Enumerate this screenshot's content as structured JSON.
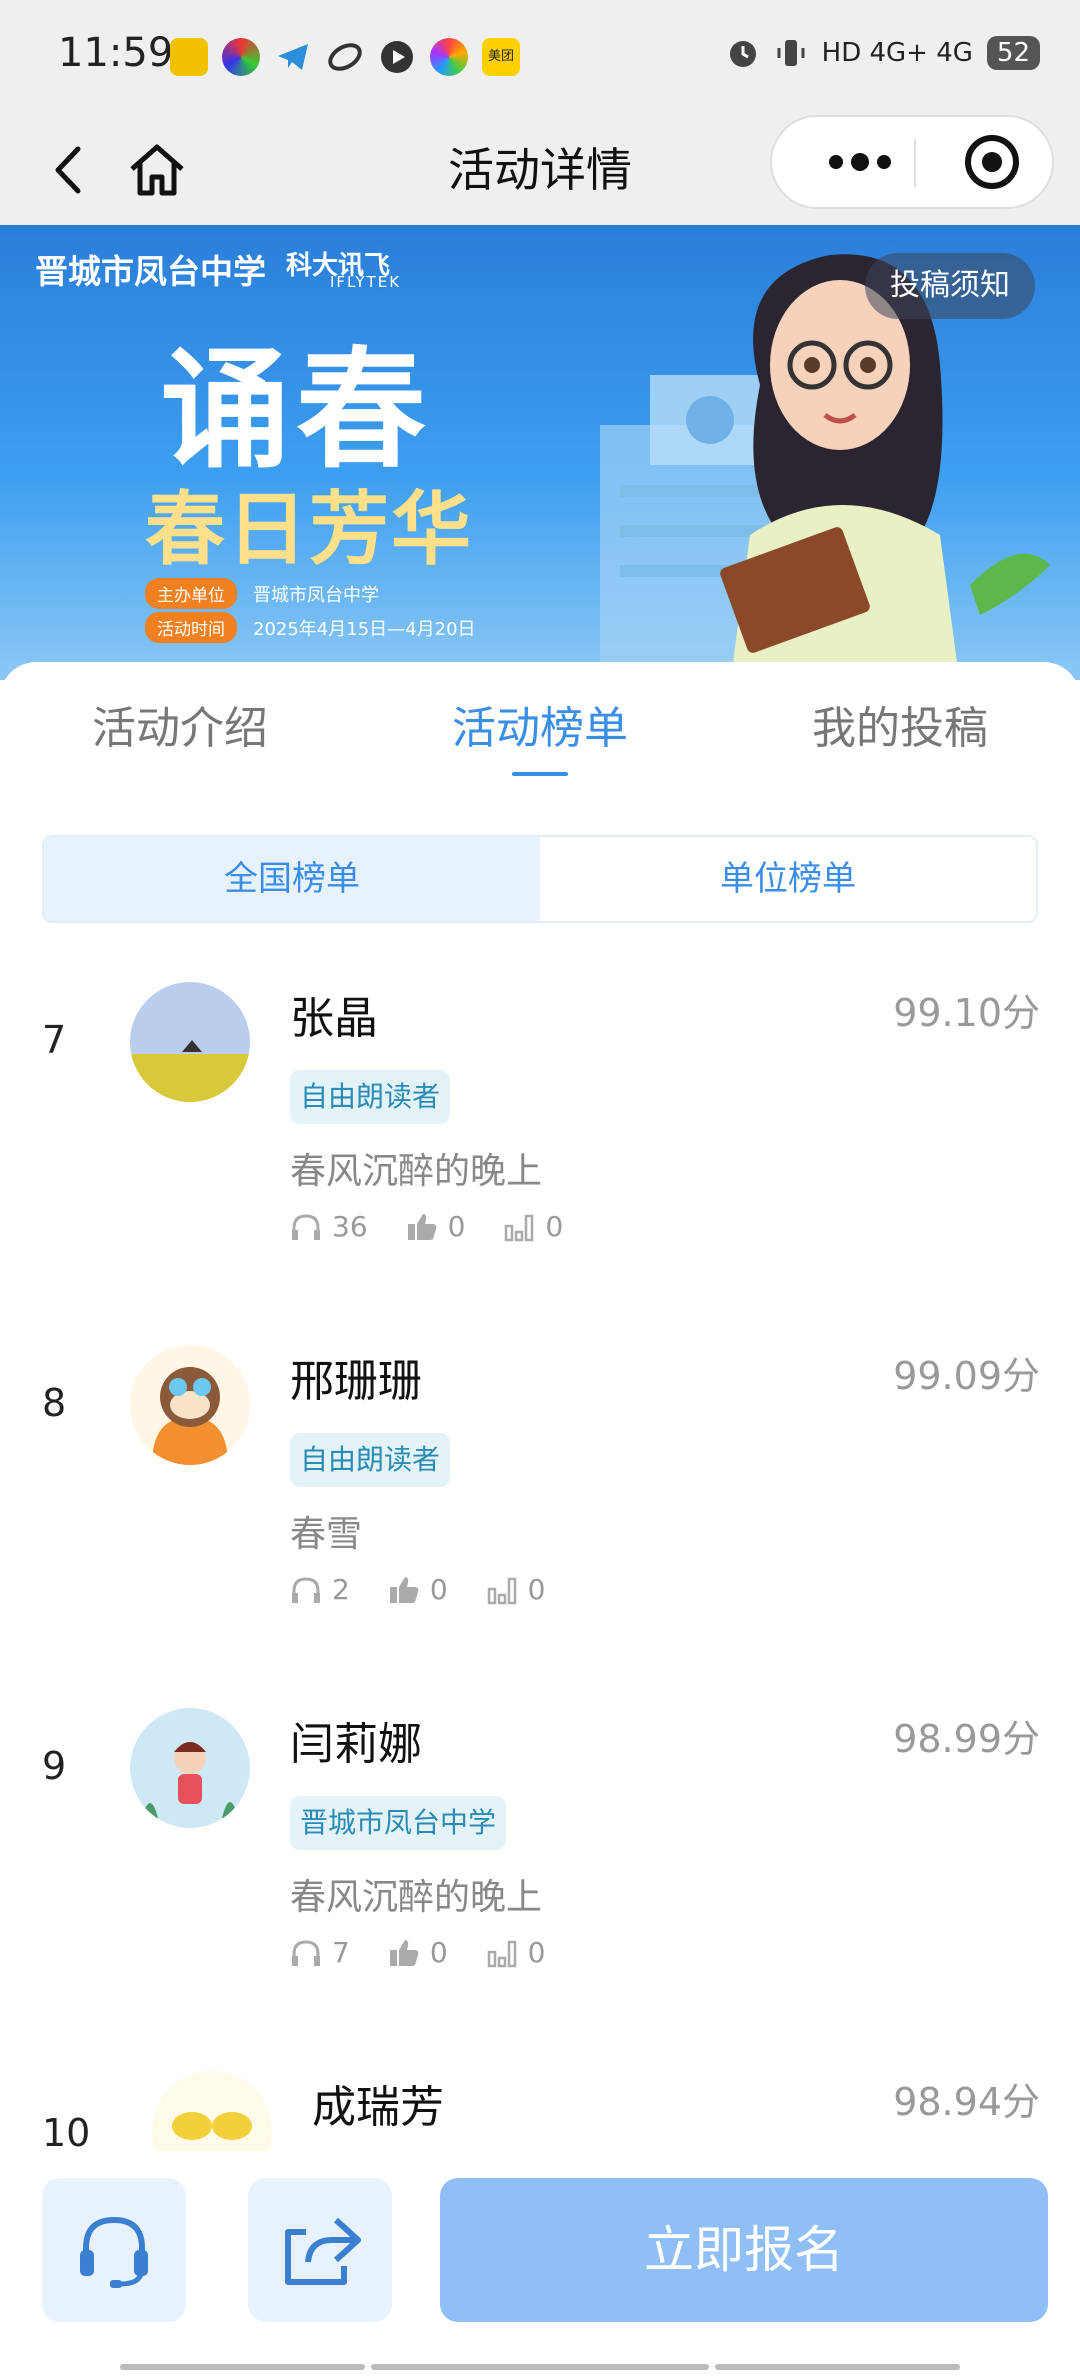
{
  "status_bar": {
    "time": "11:59",
    "notification_icons": [
      "tool-app-icon",
      "color-app-icon",
      "telegram-icon",
      "pay-app-icon",
      "video-app-icon",
      "photos-app-icon",
      "meituan-icon"
    ],
    "meituan_label": "美团",
    "signal_text": "HD 4G+ 4G",
    "battery": "52"
  },
  "nav": {
    "title": "活动详情"
  },
  "banner": {
    "school": "晋城市凤台中学",
    "brand": "科大讯飞",
    "brand_sub": "IFLYTEK",
    "title_line1": "诵春",
    "title_line2": "春日芳华",
    "organizer_tag": "主办单位",
    "organizer": "晋城市凤台中学",
    "time_tag": "活动时间",
    "time": "2025年4月15日—4月20日",
    "notice_button": "投稿须知"
  },
  "tabs": [
    {
      "label": "活动介绍",
      "active": false
    },
    {
      "label": "活动榜单",
      "active": true
    },
    {
      "label": "我的投稿",
      "active": false
    }
  ],
  "subtabs": [
    {
      "label": "全国榜单",
      "active": true
    },
    {
      "label": "单位榜单",
      "active": false
    }
  ],
  "ranking": [
    {
      "rank": "7",
      "name": "张晶",
      "score": "99.10分",
      "badge": "自由朗读者",
      "work": "春风沉醉的晚上",
      "listens": "36",
      "likes": "0",
      "votes": "0"
    },
    {
      "rank": "8",
      "name": "邢珊珊",
      "score": "99.09分",
      "badge": "自由朗读者",
      "work": "春雪",
      "listens": "2",
      "likes": "0",
      "votes": "0"
    },
    {
      "rank": "9",
      "name": "闫莉娜",
      "score": "98.99分",
      "badge": "晋城市凤台中学",
      "work": "春风沉醉的晚上",
      "listens": "7",
      "likes": "0",
      "votes": "0"
    },
    {
      "rank": "10",
      "name": "成瑞芳",
      "score": "98.94分"
    }
  ],
  "bottom": {
    "signup_label": "立即报名"
  },
  "colors": {
    "accent": "#3a8ee6",
    "signup_bg": "#8fbff5",
    "badge_bg": "#e4f3f8",
    "badge_text": "#2a8bb5"
  }
}
